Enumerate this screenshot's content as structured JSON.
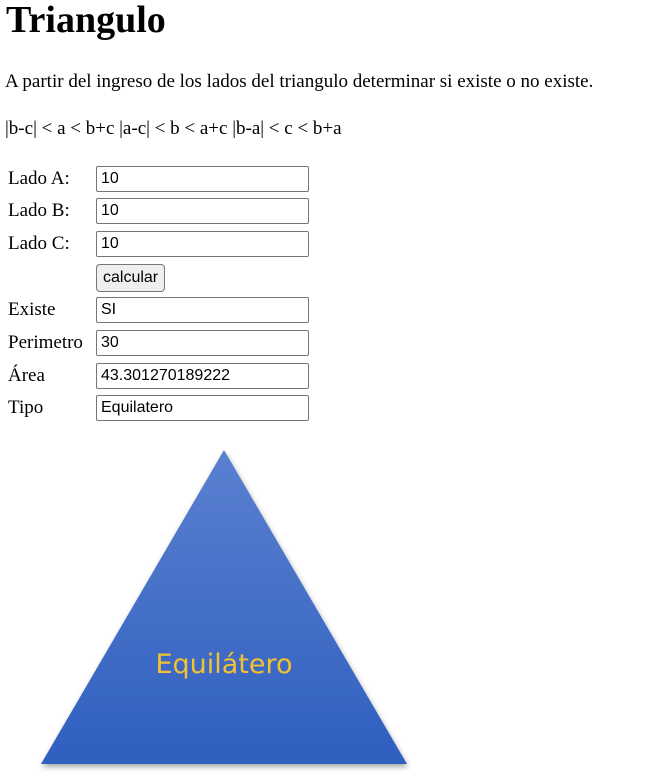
{
  "page": {
    "title": "Triangulo",
    "description": "A partir del ingreso de los lados del triangulo determinar si existe o no existe.",
    "condition": "|b-c| < a < b+c |a-c| < b < a+c |b-a| < c < b+a"
  },
  "form": {
    "side_a": {
      "label": "Lado A:",
      "value": "10"
    },
    "side_b": {
      "label": "Lado B:",
      "value": "10"
    },
    "side_c": {
      "label": "Lado C:",
      "value": "10"
    },
    "calculate_label": "calcular",
    "exists": {
      "label": "Existe",
      "value": "SI"
    },
    "perimeter": {
      "label": "Perimetro",
      "value": "30"
    },
    "area": {
      "label": "Área",
      "value": "43.301270189222"
    },
    "type": {
      "label": "Tipo",
      "value": "Equilatero"
    }
  },
  "figure": {
    "caption": "Equilátero",
    "shape": "equilateral-triangle",
    "fill_top": "#5a80d0",
    "fill_bottom": "#2f5fbf",
    "caption_color": "#f1c232"
  }
}
